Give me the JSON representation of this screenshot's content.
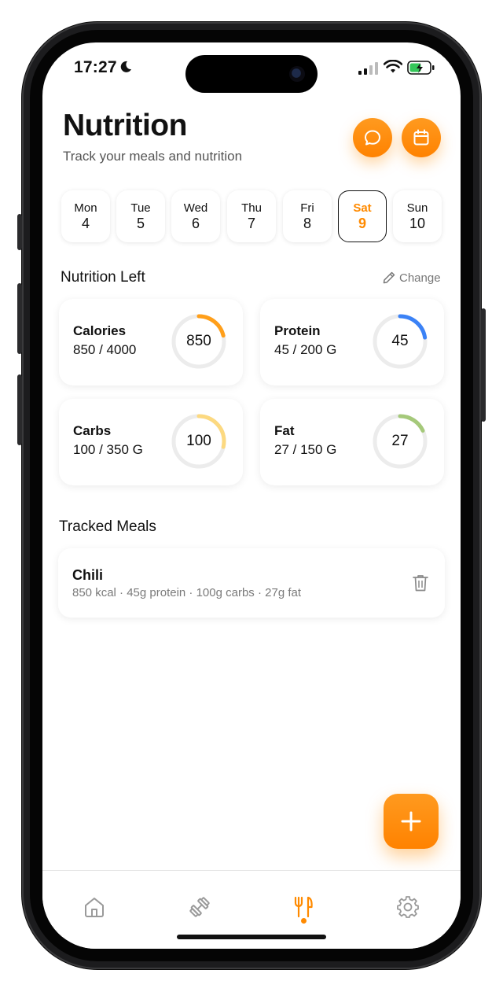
{
  "status": {
    "time": "17:27"
  },
  "header": {
    "title": "Nutrition",
    "subtitle": "Track your meals and nutrition",
    "chat_icon": "chat-bubble-icon",
    "calendar_icon": "calendar-icon"
  },
  "days": [
    {
      "name": "Mon",
      "date": "4",
      "selected": false
    },
    {
      "name": "Tue",
      "date": "5",
      "selected": false
    },
    {
      "name": "Wed",
      "date": "6",
      "selected": false
    },
    {
      "name": "Thu",
      "date": "7",
      "selected": false
    },
    {
      "name": "Fri",
      "date": "8",
      "selected": false
    },
    {
      "name": "Sat",
      "date": "9",
      "selected": true
    },
    {
      "name": "Sun",
      "date": "10",
      "selected": false
    }
  ],
  "nutrition_left": {
    "title": "Nutrition Left",
    "change_label": "Change",
    "cards": [
      {
        "label": "Calories",
        "value_text": "850 / 4000",
        "ring_value": "850",
        "fraction": 0.2125,
        "color": "#ff9f1a"
      },
      {
        "label": "Protein",
        "value_text": "45 / 200 G",
        "ring_value": "45",
        "fraction": 0.225,
        "color": "#3b82f6"
      },
      {
        "label": "Carbs",
        "value_text": "100 / 350 G",
        "ring_value": "100",
        "fraction": 0.2857,
        "color": "#fcd980"
      },
      {
        "label": "Fat",
        "value_text": "27 / 150 G",
        "ring_value": "27",
        "fraction": 0.18,
        "color": "#a5c97a"
      }
    ]
  },
  "tracked_meals": {
    "title": "Tracked Meals",
    "items": [
      {
        "name": "Chili",
        "details": "850 kcal · 45g protein · 100g carbs · 27g fat"
      }
    ]
  },
  "tabbar": {
    "items": [
      "home-icon",
      "dumbbell-icon",
      "fork-knife-icon",
      "gear-icon"
    ],
    "active_index": 2,
    "accent": "#ff8a00"
  }
}
